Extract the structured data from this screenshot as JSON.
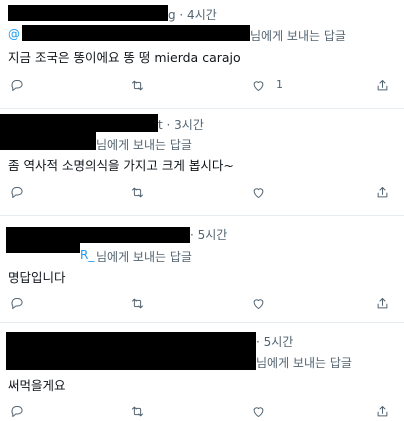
{
  "replies": [
    {
      "meta_visible": "g · 4시간",
      "handle_prefix": "@",
      "replying_to": "님에게 보내는 답글",
      "text": "지금 조국은 똥이에요 똥 떵 mierda carajo",
      "like_count": "1"
    },
    {
      "meta_visible": "t · 3시간",
      "replying_to": "님에게 보내는 답글",
      "text": "좀 역사적 소명의식을 가지고 크게  봅시다~",
      "like_count": ""
    },
    {
      "meta_visible": "· 5시간",
      "handle_tail": "R_",
      "replying_to": "님에게 보내는 답글",
      "text": "명답입니다",
      "like_count": ""
    },
    {
      "meta_visible": "· 5시간",
      "replying_to": "님에게 보내는 답글",
      "text": "써먹을게요",
      "like_count": ""
    }
  ],
  "icons": {
    "reply": "reply-icon",
    "retweet": "retweet-icon",
    "like": "like-icon",
    "share": "share-icon"
  },
  "colors": {
    "link": "#1d9bf0",
    "secondary": "#536471",
    "divider": "#e6ecf0"
  }
}
